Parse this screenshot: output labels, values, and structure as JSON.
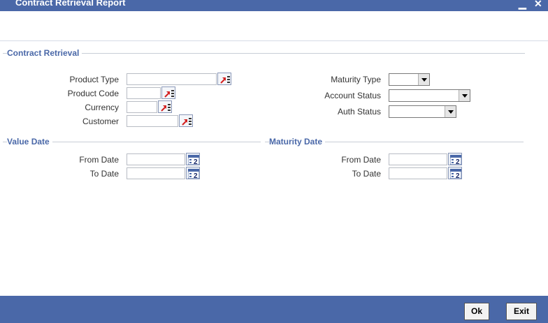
{
  "window": {
    "title": "Contract Retrieval Report",
    "minimize_glyph": "▁",
    "close_glyph": "✕"
  },
  "sections": {
    "contract_retrieval": "Contract Retrieval",
    "value_date": "Value Date",
    "maturity_date": "Maturity Date"
  },
  "contract_retrieval": {
    "product_type": {
      "label": "Product Type",
      "value": ""
    },
    "product_code": {
      "label": "Product Code",
      "value": ""
    },
    "currency": {
      "label": "Currency",
      "value": ""
    },
    "customer": {
      "label": "Customer",
      "value": ""
    },
    "maturity_type": {
      "label": "Maturity Type",
      "selected": ""
    },
    "account_status": {
      "label": "Account Status",
      "selected": ""
    },
    "auth_status": {
      "label": "Auth Status",
      "selected": ""
    }
  },
  "value_date": {
    "from_label": "From Date",
    "from_value": "",
    "to_label": "To Date",
    "to_value": ""
  },
  "maturity_date": {
    "from_label": "From Date",
    "from_value": "",
    "to_label": "To Date",
    "to_value": ""
  },
  "buttons": {
    "ok": "Ok",
    "exit": "Exit"
  },
  "icons": {
    "lov": "list-of-values-icon",
    "calendar": "calendar-icon"
  },
  "colors": {
    "brand_blue": "#4a68a8",
    "lov_red": "#d42020"
  }
}
